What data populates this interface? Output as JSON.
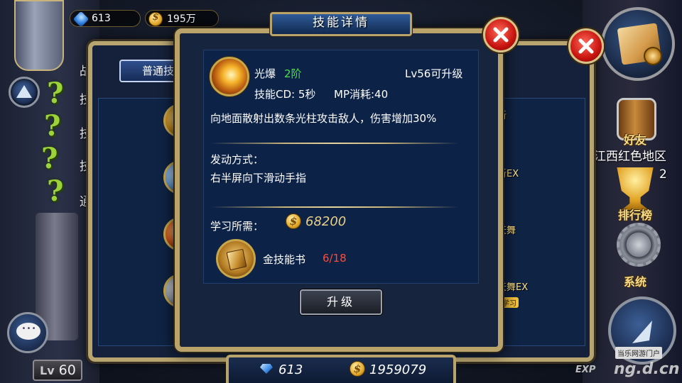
{
  "top_bar": {
    "gems": "613",
    "gold": "195万"
  },
  "left_hud": {
    "label_truncated": "战斗",
    "quest_labels": [
      "技",
      "技",
      "技",
      "通"
    ]
  },
  "right_hud": {
    "friends_label": "好友",
    "region_label": "江西红色地区",
    "region_value": "2",
    "ranking_label": "排行榜",
    "system_label": "系统"
  },
  "back_panel": {
    "tab_label": "普通技",
    "right_skills": [
      "新",
      "新EX",
      "天舞",
      "天舞EX"
    ],
    "learn_badge": "学习"
  },
  "dialog": {
    "title": "技能详情",
    "skill": {
      "name": "光爆",
      "rank": "2阶",
      "upgrade_level": "Lv56可升级",
      "cooldown": "技能CD: 5秒",
      "mp_cost": "MP消耗:40",
      "description": "向地面散射出数条光柱攻击敌人，伤害增加30%"
    },
    "trigger": {
      "heading": "发动方式：",
      "method": "右半屏向下滑动手指"
    },
    "requirements": {
      "heading": "学习所需：",
      "gold_cost": "68200",
      "item_name": "金技能书",
      "item_count": "6/18"
    },
    "upgrade_button": "升级"
  },
  "bottom_bar": {
    "gems": "613",
    "gold": "1959079"
  },
  "player": {
    "level_prefix": "Lv",
    "level": "60",
    "exp_label": "EXP"
  },
  "watermark": {
    "site": "ng.d.cn",
    "portal": "当乐网游门户"
  },
  "colors": {
    "frame_gold": "#b9a36b",
    "panel_blue": "#0d2247",
    "rank_green": "#49e04a",
    "count_red": "#ff4b3a",
    "close_red": "#c8140f"
  },
  "icons": {
    "close": "close-x-icon",
    "gem": "diamond-gem-icon",
    "gold": "gold-coin-icon",
    "skill": "light-burst-skill-icon",
    "book": "golden-skill-book-icon",
    "chat": "chat-bubble-icon",
    "map": "world-map-icon",
    "friends": "barrel-icon",
    "ranking": "trophy-icon",
    "system": "gear-icon"
  }
}
